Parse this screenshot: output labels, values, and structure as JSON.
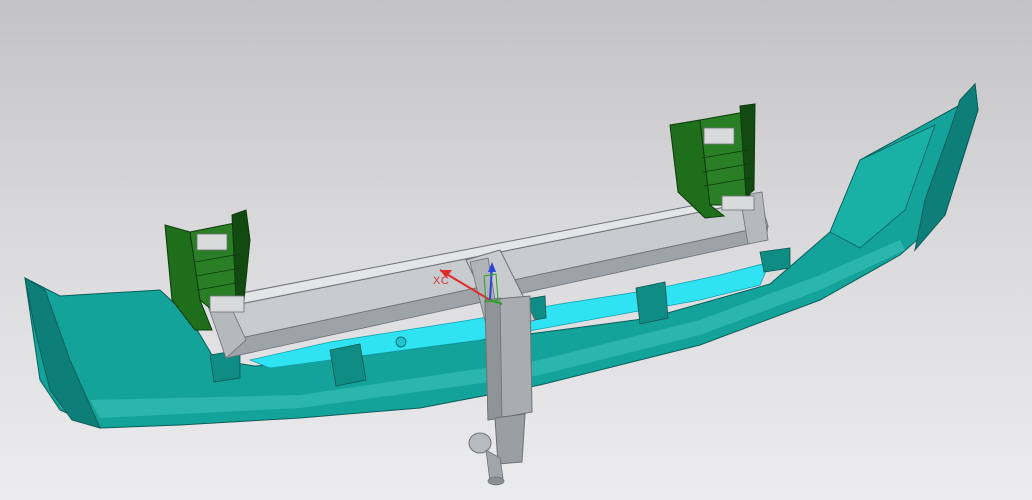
{
  "viewport": {
    "background_top": "#c3c3c6",
    "background_bottom": "#ececee"
  },
  "colors": {
    "bumper": "#14a39a",
    "bumper_dark": "#0d7e78",
    "bumper_light": "#3ec7bd",
    "inner_cyan": "#2fe3f2",
    "bracket": "#1f6e1c",
    "bracket_dark": "#124a11",
    "beam": "#c9cccf",
    "beam_shadow": "#9ea3a8",
    "tow_bar": "#a9adb2",
    "xc_axis": "#e02b2b",
    "yc_axis": "#2a45d8",
    "zc_axis": "#27a327"
  },
  "triad": {
    "xc_label": "XC",
    "icon": "wcs-triad-icon"
  }
}
